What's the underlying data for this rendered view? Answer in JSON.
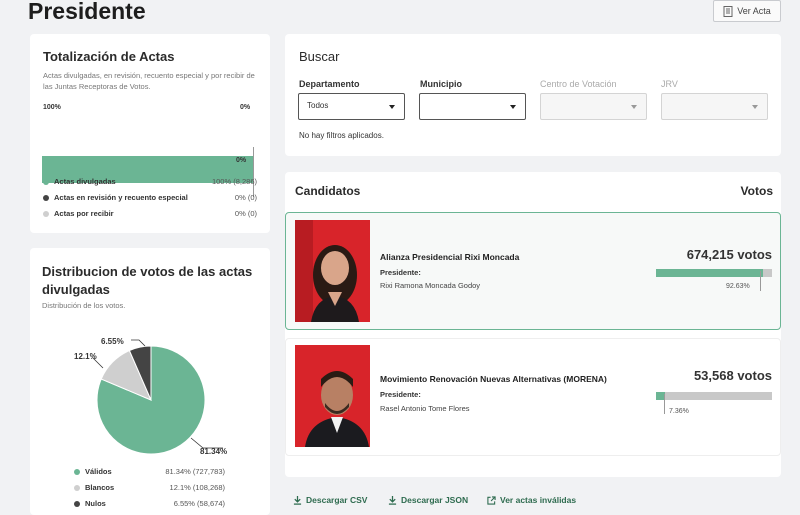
{
  "page": {
    "title": "Presidente",
    "ver_acta": "Ver Acta"
  },
  "totalizacion": {
    "title": "Totalización de Actas",
    "subtitle": "Actas divulgadas, en revisión, recuento especial y por recibir de las Juntas Receptoras de Votos.",
    "bar_left_label": "100%",
    "bar_right_label": "0%",
    "bar_bottom_label": "0%",
    "divulgadas_fraction": 1.0,
    "legend": [
      {
        "label": "Actas divulgadas",
        "value": "100% (8,286)",
        "color": "#6bb594"
      },
      {
        "label": "Actas en revisión y recuento especial",
        "value": "0% (0)",
        "color": "#444444"
      },
      {
        "label": "Actas por recibir",
        "value": "0% (0)",
        "color": "#cfcfcf"
      }
    ]
  },
  "distribucion": {
    "title": "Distribucion de votos de las actas divulgadas",
    "subtitle": "Distribución de los votos.",
    "pie_labels": {
      "validos": "81.34%",
      "blancos": "12.1%",
      "nulos": "6.55%"
    },
    "legend": [
      {
        "label": "Válidos",
        "value": "81.34% (727,783)",
        "color": "#6bb594"
      },
      {
        "label": "Blancos",
        "value": "12.1% (108,268)",
        "color": "#cfcfcf"
      },
      {
        "label": "Nulos",
        "value": "6.55% (58,674)",
        "color": "#444444"
      }
    ]
  },
  "chart_data": {
    "type": "pie",
    "categories": [
      "Válidos",
      "Blancos",
      "Nulos"
    ],
    "values": [
      81.34,
      12.1,
      6.55
    ],
    "counts": [
      727783,
      108268,
      58674
    ],
    "colors": [
      "#6bb594",
      "#cfcfcf",
      "#444444"
    ]
  },
  "buscar": {
    "title": "Buscar",
    "filters": [
      {
        "label": "Departamento",
        "value": "Todos",
        "disabled": false
      },
      {
        "label": "Municipio",
        "value": "",
        "disabled": false
      },
      {
        "label": "Centro de Votación",
        "value": "",
        "disabled": true
      },
      {
        "label": "JRV",
        "value": "",
        "disabled": true
      }
    ],
    "no_filters": "No hay filtros aplicados."
  },
  "candidatos": {
    "header_left": "Candidatos",
    "header_right": "Votos",
    "list": [
      {
        "party": "Alianza Presidencial Rixi Moncada",
        "role": "Presidente:",
        "name": "Rixi Ramona Moncada Godoy",
        "votes": "674,215 votos",
        "pct": "92.63%",
        "fraction": 0.9263,
        "selected": true
      },
      {
        "party": "Movimiento Renovación Nuevas Alternativas (MORENA)",
        "role": "Presidente:",
        "name": "Rasel Antonio Tome Flores",
        "votes": "53,568 votos",
        "pct": "7.36%",
        "fraction": 0.0736,
        "selected": false
      }
    ]
  },
  "downloads": {
    "csv": "Descargar CSV",
    "json": "Descargar JSON",
    "invalid": "Ver actas inválidas"
  }
}
